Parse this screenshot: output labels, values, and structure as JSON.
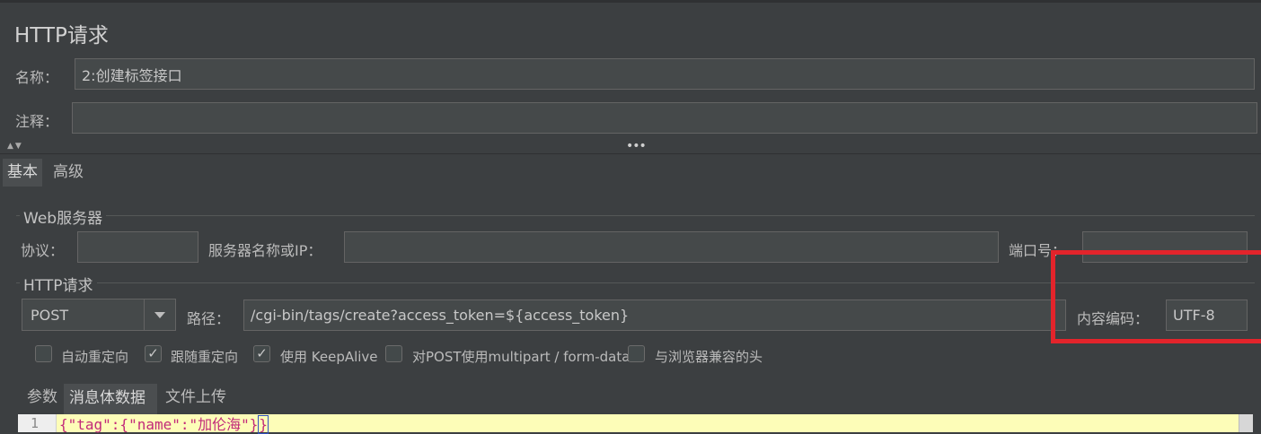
{
  "panel": {
    "title": "HTTP请求",
    "name_label": "名称：",
    "name_value": "2:创建标签接口",
    "comment_label": "注释："
  },
  "tabs": {
    "basic": "基本",
    "advanced": "高级"
  },
  "web_server": {
    "title": "Web服务器",
    "protocol_label": "协议：",
    "protocol_value": "",
    "server_label": "服务器名称或IP：",
    "server_value": "",
    "port_label": "端口号："
  },
  "http_request": {
    "title": "HTTP请求",
    "method": "POST",
    "path_label": "路径：",
    "path_value": "/cgi-bin/tags/create?access_token=${access_token}",
    "encoding_label": "内容编码：",
    "encoding_value": "UTF-8"
  },
  "options": [
    {
      "label": "自动重定向",
      "checked": false
    },
    {
      "label": "跟随重定向",
      "checked": true
    },
    {
      "label": "使用 KeepAlive",
      "checked": true
    },
    {
      "label": "对POST使用multipart / form-data",
      "checked": false
    },
    {
      "label": "与浏览器兼容的头",
      "checked": false
    }
  ],
  "body_tabs": {
    "params": "参数",
    "body_data": "消息体数据",
    "file_upload": "文件上传"
  },
  "editor": {
    "line_number": "1",
    "code_text": "{\"tag\":{\"name\":\"加伦海\"}",
    "code_tail": "}"
  },
  "check_mark": "✓",
  "colors": {
    "background": "#3c3f41",
    "field": "#45494a",
    "highlight": "#e3242b",
    "editor_bg": "#fdfdb8"
  }
}
